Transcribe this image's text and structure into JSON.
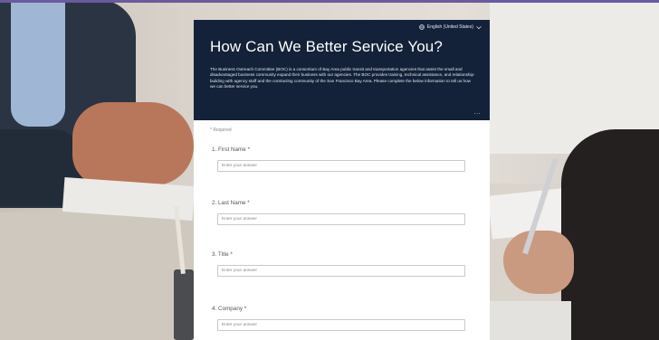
{
  "form": {
    "language_label": "English (United States)",
    "title": "How Can We Better Service You?",
    "description": "The Business Outreach Committee (BOC) is a consortium of Bay Area public transit and transportation agencies that assist the small and disadvantaged business community expand their business with our agencies. The BOC provides training, technical assistance, and relationship-building with agency staff and the contracting community of the San Francisco Bay Area. Please complete the below information to tell us how we can better service you.",
    "more_label": "...",
    "required_note": "* Required",
    "questions": [
      {
        "number": "1.",
        "label": "First Name",
        "star": "*",
        "placeholder": "Enter your answer"
      },
      {
        "number": "2.",
        "label": "Last Name",
        "star": "*",
        "placeholder": "Enter your answer"
      },
      {
        "number": "3.",
        "label": "Title",
        "star": "*",
        "placeholder": "Enter your answer"
      },
      {
        "number": "4.",
        "label": "Company",
        "star": "*",
        "placeholder": "Enter your answer"
      }
    ]
  },
  "colors": {
    "banner": "#132238",
    "accent_line": "#6a5a9e",
    "required_star": "#a33636"
  },
  "icons": {
    "language": "globe-icon",
    "dropdown": "chevron-down-icon",
    "more": "more-options-icon"
  }
}
